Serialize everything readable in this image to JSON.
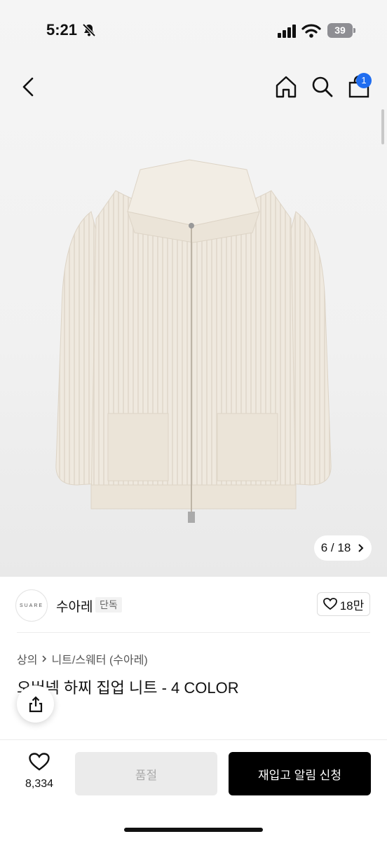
{
  "status": {
    "time": "5:21",
    "battery": "39"
  },
  "nav": {
    "cart_count": "1"
  },
  "gallery": {
    "current": "6",
    "total": "18",
    "separator": "/"
  },
  "brand": {
    "logo_text": "SUARE",
    "name": "수아레",
    "tag": "단독",
    "likes": "18만"
  },
  "breadcrumb": {
    "category": "상의",
    "sub": "니트/스웨터 (수아레)"
  },
  "product": {
    "title": "오버넥 하찌 집업 니트 - 4 COLOR"
  },
  "bottom": {
    "wish_count": "8,334",
    "soldout_label": "품절",
    "restock_label": "재입고 알림 신청"
  },
  "colors": {
    "accent_badge": "#1f6df0",
    "primary_button": "#000000",
    "disabled_button": "#ebebeb",
    "knit": "#efe9df"
  }
}
